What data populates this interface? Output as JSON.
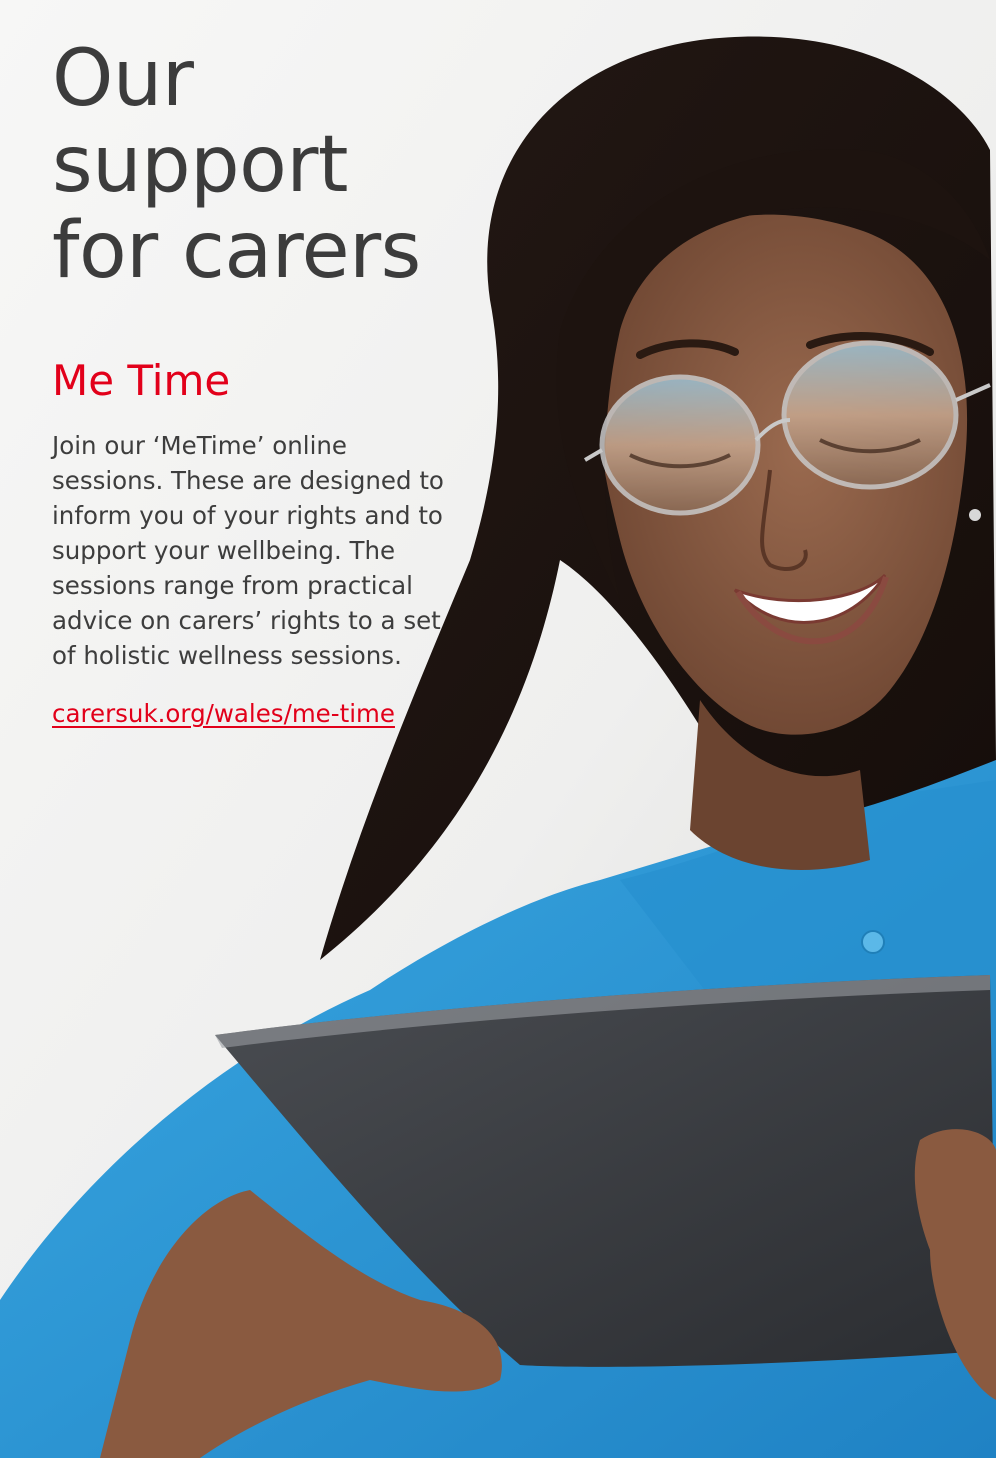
{
  "headline": {
    "line1": "Our support",
    "line2": "for carers"
  },
  "section": {
    "title": "Me Time",
    "body": "Join our ‘MeTime’ online sessions. These are designed to inform you of your rights and to support your wellbeing. The sessions range from practical advice on carers’ rights to a set of holistic wellness sessions.",
    "link_text": "carersuk.org/wales/me-time"
  },
  "colors": {
    "accent": "#e2001a",
    "text": "#3c3c3c",
    "shirt": "#2f9ad6",
    "tablet": "#3a3d42"
  },
  "photo": {
    "subject": "smiling woman with glasses looking at a tablet"
  }
}
